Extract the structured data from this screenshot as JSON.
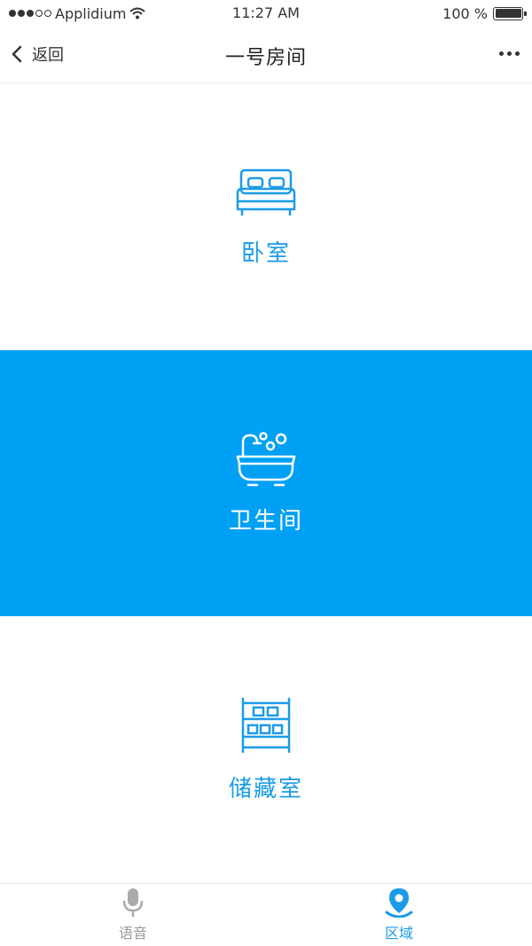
{
  "status": {
    "carrier": "Applidium",
    "time": "11:27 AM",
    "battery": "100 %"
  },
  "nav": {
    "back_label": "返回",
    "title": "一号房间"
  },
  "rooms": [
    {
      "label": "卧室",
      "icon": "bed-icon"
    },
    {
      "label": "卫生间",
      "icon": "bathtub-icon",
      "active": true
    },
    {
      "label": "储藏室",
      "icon": "shelf-icon"
    }
  ],
  "tabs": [
    {
      "label": "语音",
      "icon": "microphone-icon"
    },
    {
      "label": "区域",
      "icon": "location-pin-icon",
      "active": true
    }
  ],
  "colors": {
    "accent": "#1a9be8",
    "active_bg": "#00a0f5"
  }
}
